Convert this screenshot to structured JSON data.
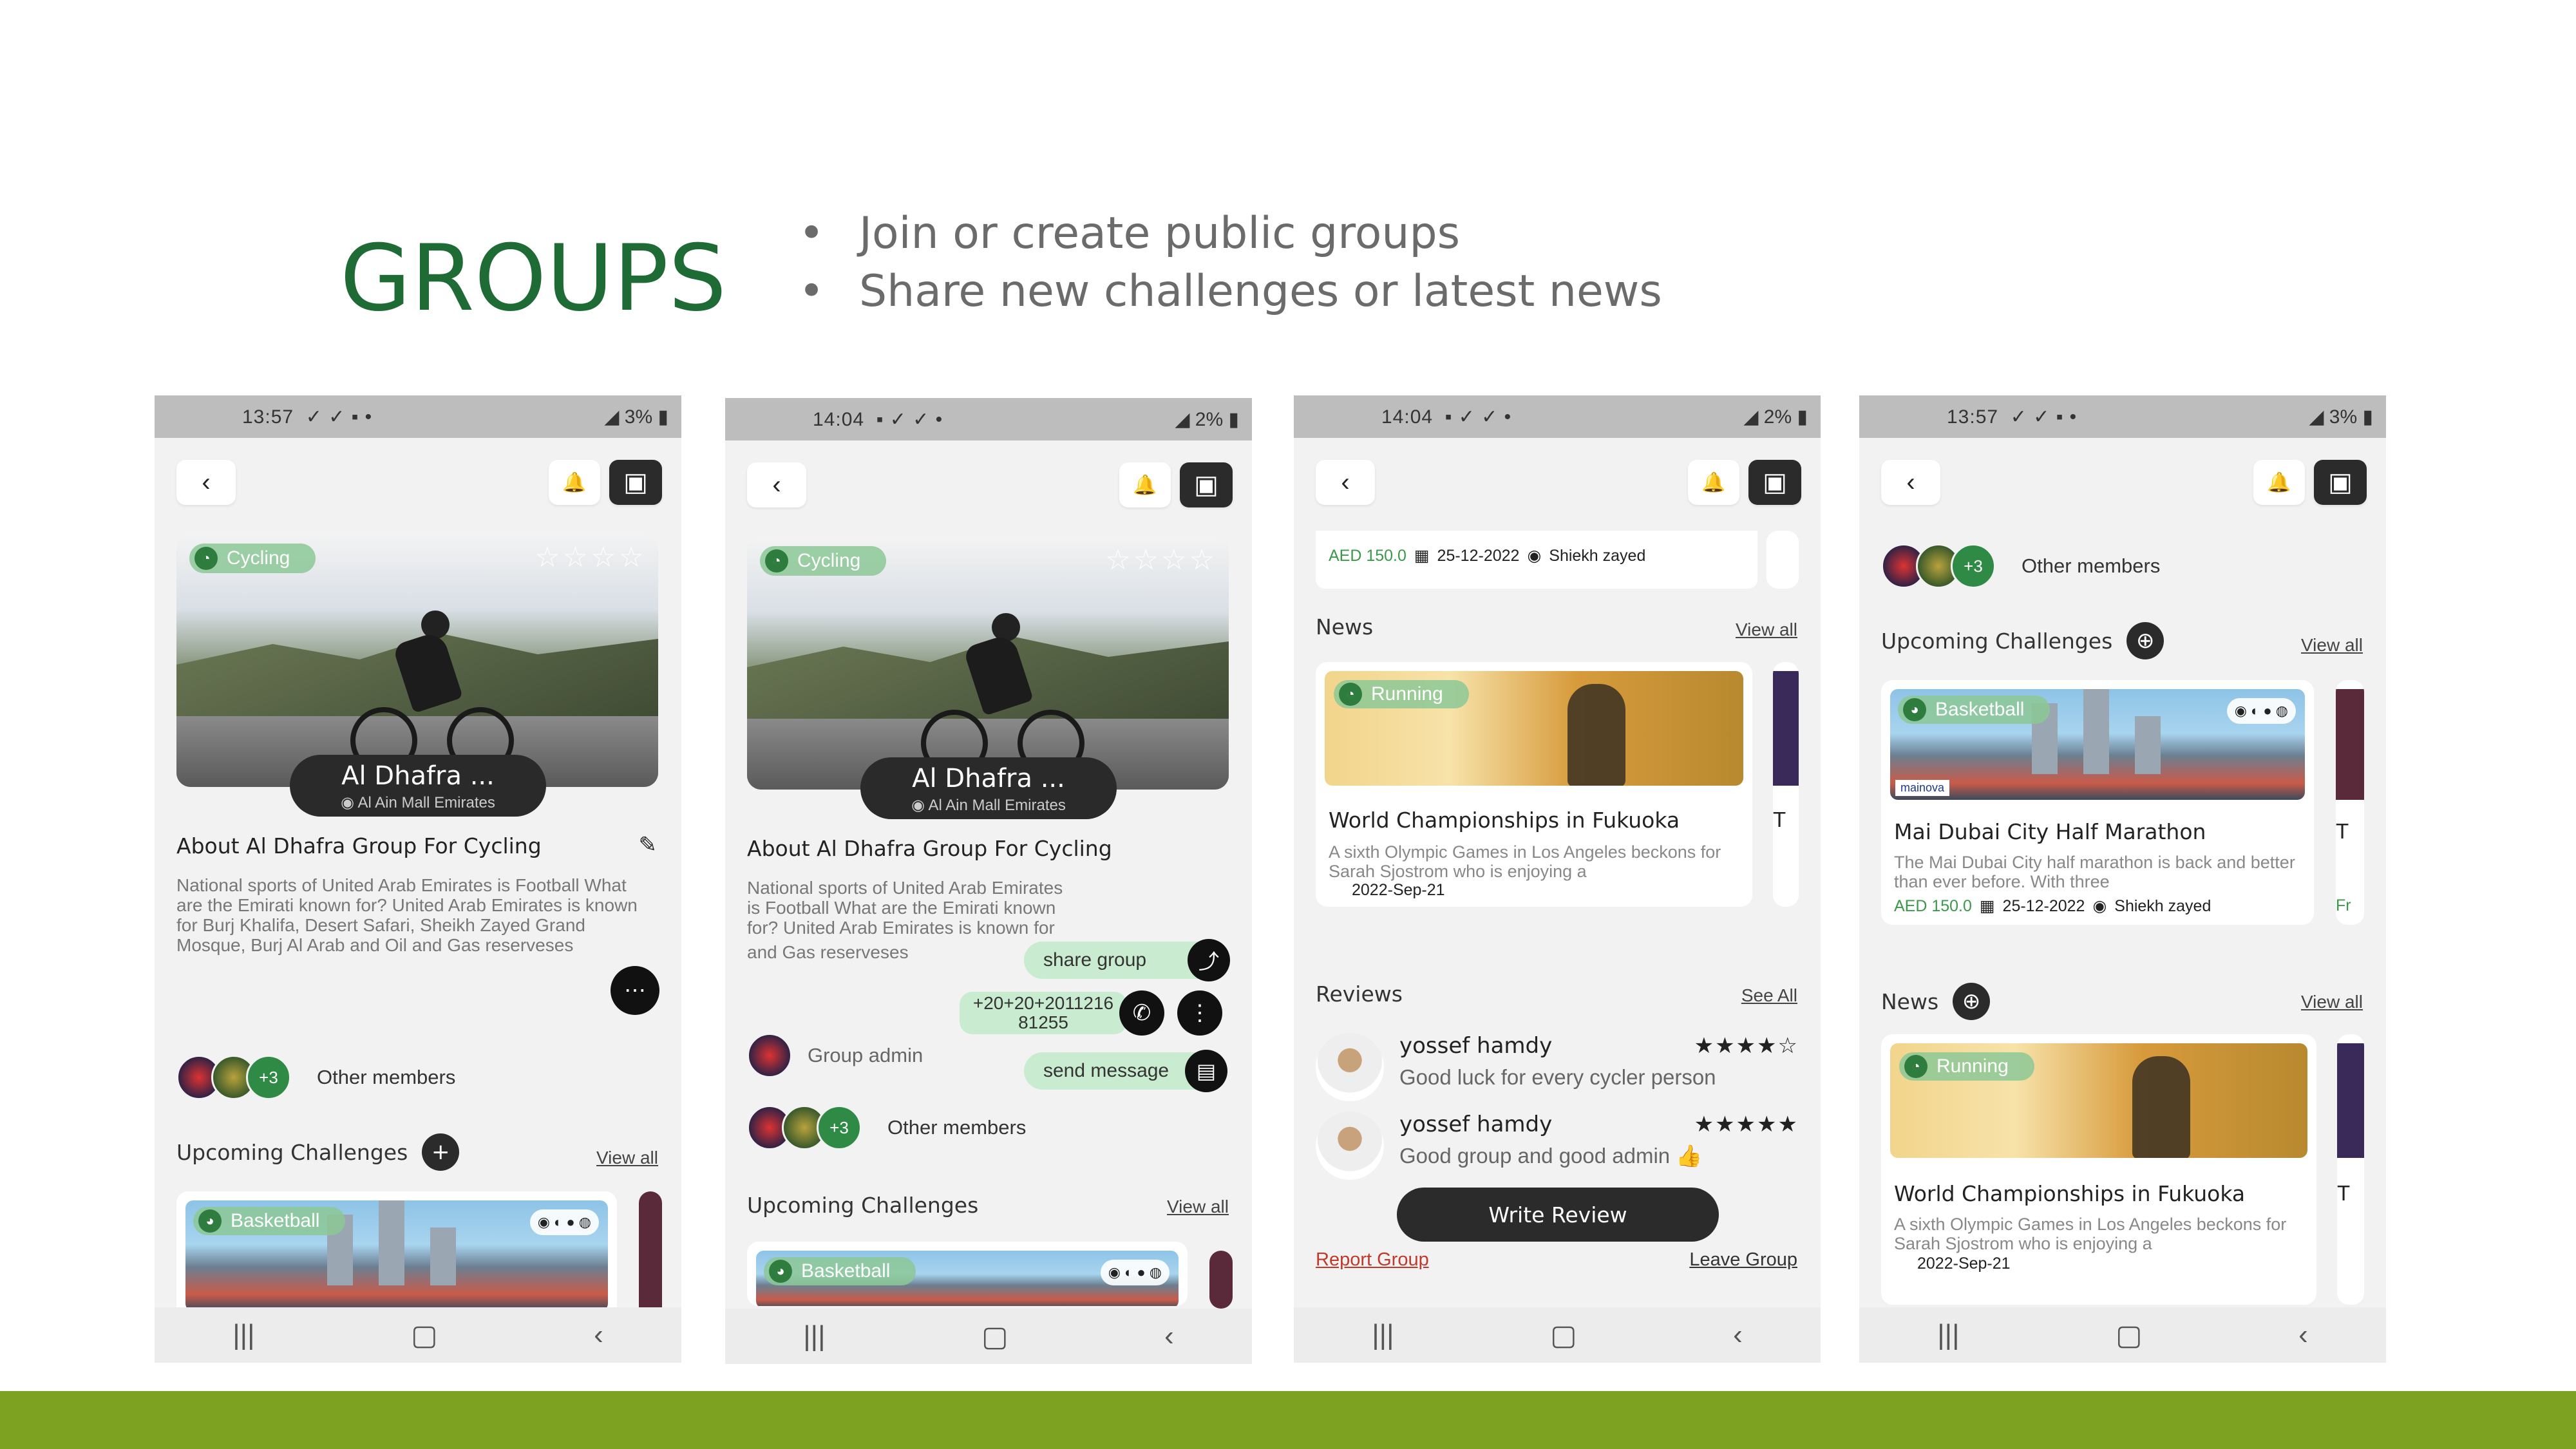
{
  "slide": {
    "title": "GROUPS",
    "bullets": [
      "Join or create public groups",
      "Share new challenges or latest news"
    ]
  },
  "colors": {
    "title_green": "#1e6b35",
    "footer_green": "#7da222",
    "pill_green": "#c9ecd0",
    "price_green": "#3a9a4a",
    "dark": "#2b2b2b"
  },
  "common": {
    "group_name": "Al Dhafra ...",
    "group_location": "Al Ain Mall Emirates",
    "sport_tag": "Cycling",
    "about_title": "About Al Dhafra Group For Cycling",
    "about_text": "National sports of United Arab Emirates is Football What are the Emirati known for? United Arab Emirates is known for Burj Khalifa, Desert Safari, Sheikh Zayed Grand Mosque, Burj Al Arab and Oil and Gas reserveses",
    "about_text_truncated": "National sports of United Arab Emirates is Football What are the Emirati known for? United Arab Emirates is known for Burj Khalifa, Desert Safari, Sheikh Zayed Grand Mosque, B",
    "about_text_end": "and Gas reserveses",
    "members_extra": "+3",
    "other_members": "Other  members",
    "upcoming_challenges": "Upcoming Challenges",
    "view_all": "View all",
    "see_all": "See All",
    "news": "News",
    "reviews": "Reviews",
    "basketball": "Basketball",
    "running": "Running",
    "challenge_title": "Mai Dubai City Half Marathon",
    "challenge_text": "The Mai Dubai City half marathon is back and better than ever before. With three",
    "challenge_price": "AED 150.0",
    "challenge_date": "25-12-2022",
    "challenge_place": "Shiekh zayed",
    "news_title": "World Championships in Fukuoka",
    "news_text": "A sixth Olympic Games in Los Angeles beckons for Sarah Sjostrom who is enjoying a",
    "news_date": "2022-Sep-21",
    "peek_T": "T",
    "peek_F": "Fr",
    "sponsor": "mainova"
  },
  "phones": [
    {
      "time": "13:57",
      "battery": "3%",
      "status_icons": "✓ ✓ ▪ •"
    },
    {
      "time": "14:04",
      "battery": "2%",
      "status_icons": "▪ ✓ ✓ •"
    },
    {
      "time": "14:04",
      "battery": "2%",
      "status_icons": "▪ ✓ ✓ •"
    },
    {
      "time": "13:57",
      "battery": "3%",
      "status_icons": "✓ ✓ ▪ •"
    }
  ],
  "phone2": {
    "share_group": "share group",
    "phone_number": "+20+20+2011216\n81255",
    "group_admin": "Group admin",
    "send_message": "send message"
  },
  "phone3": {
    "reviewers": [
      {
        "name": "yossef hamdy",
        "rating": 4,
        "text": "Good luck for every cycler person",
        "stars": "★★★★☆"
      },
      {
        "name": "yossef hamdy",
        "rating": 5,
        "text": "Good group and good admin 👍",
        "stars": "★★★★★"
      }
    ],
    "write_review": "Write Review",
    "report_group": "Report Group",
    "leave_group": "Leave Group"
  },
  "icons": {
    "back": "‹",
    "bell": "🔔",
    "store": "▣",
    "more": "⋯",
    "share": "⤴",
    "phone": "✆",
    "kebab": "⋮",
    "message": "▤",
    "nav_recent": "|||",
    "nav_home": "▢",
    "nav_back": "‹",
    "pin": "◉",
    "calendar": "▦",
    "plus": "⊕",
    "stars_empty": "☆☆☆☆"
  }
}
